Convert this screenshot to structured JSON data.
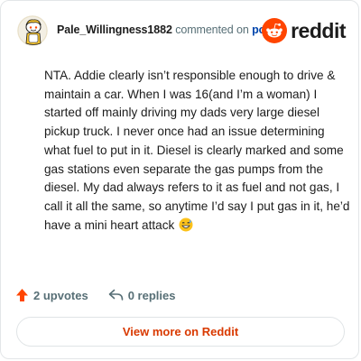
{
  "header": {
    "username": "Pale_Willingness1882",
    "action_text": "commented on",
    "post_link": "post",
    "brand": "reddit"
  },
  "comment": {
    "body": "NTA. Addie clearly isn’t responsible enough to drive & maintain a car. When I was 16(and I’m a woman) I started off mainly driving my dads very large diesel pickup truck. I never once had an issue determining what fuel to put in it. Diesel is clearly marked and some gas stations even separate the gas pumps from the diesel. My dad always refers to it as fuel and not gas, I call it all the same, so anytime I’d say I put gas in it, he’d have a mini heart attack",
    "emoji": "grinning-sweat-emoji"
  },
  "footer": {
    "upvotes": "2 upvotes",
    "replies": "0 replies"
  },
  "cta": {
    "label": "View more on Reddit"
  },
  "colors": {
    "reddit_orange": "#ff4500",
    "link_blue": "#0045ac",
    "cta_text": "#d93900",
    "muted": "#576f76"
  }
}
